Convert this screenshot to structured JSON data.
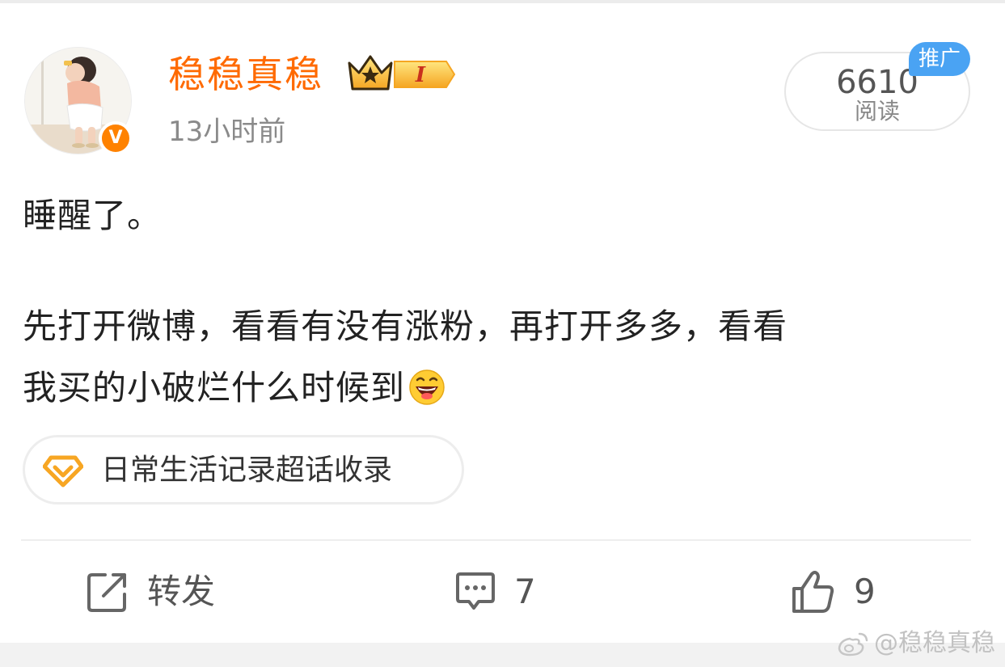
{
  "user": {
    "name": "稳稳真稳",
    "level_badge": "I",
    "verified_mark": "V",
    "time": "13小时前"
  },
  "read": {
    "count": "6610",
    "label": "阅读",
    "promo_tag": "推广"
  },
  "post": {
    "line1": "睡醒了。",
    "line2": "先打开微博，看看有没有涨粉，再打开多多，看看",
    "line3": "我买的小破烂什么时候到",
    "emoji": "laughing-emoji"
  },
  "topic": {
    "label": "日常生活记录超话收录",
    "icon": "diamond-icon"
  },
  "actions": {
    "repost_label": "转发",
    "comment_count": "7",
    "like_count": "9"
  },
  "watermark": {
    "text": "@稳稳真稳"
  },
  "colors": {
    "username": "#ff6a00",
    "verified": "#ff8200",
    "promo": "#4aa3f3",
    "topic_icon": "#f7a623"
  }
}
